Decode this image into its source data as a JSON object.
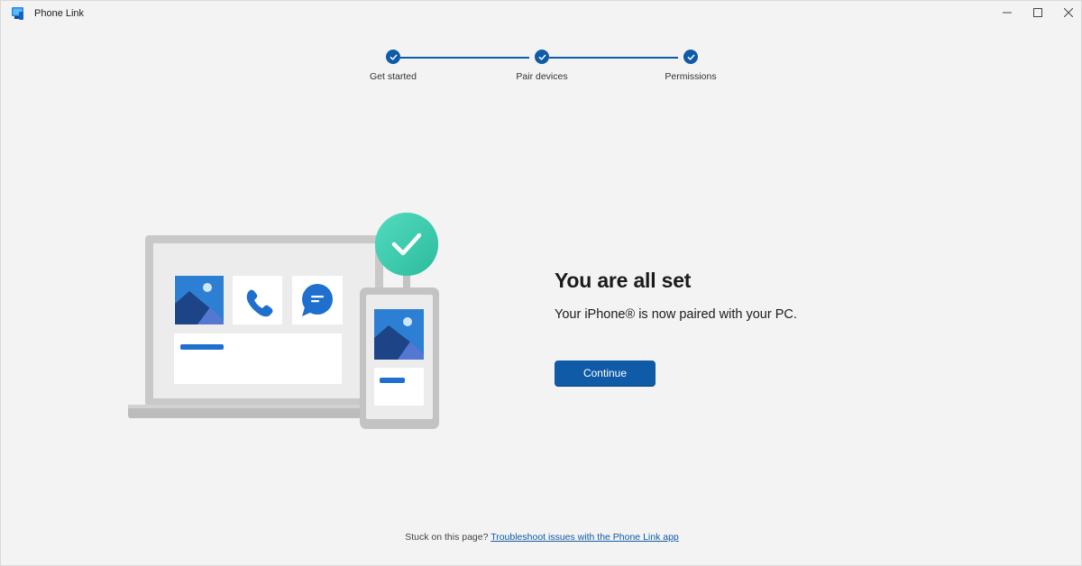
{
  "window": {
    "title": "Phone Link",
    "icons": {
      "app": "phone-link-app-icon",
      "minimize": "minimize-icon",
      "maximize": "maximize-icon",
      "close": "close-icon"
    }
  },
  "stepper": {
    "steps": [
      {
        "label": "Get started",
        "status": "complete"
      },
      {
        "label": "Pair devices",
        "status": "complete"
      },
      {
        "label": "Permissions",
        "status": "complete"
      }
    ],
    "accent_color": "#0f5ba8"
  },
  "main": {
    "heading": "You are all set",
    "subtext": "Your iPhone® is now paired with your PC.",
    "continue_label": "Continue"
  },
  "footer": {
    "prompt": "Stuck on this page?",
    "link_text": "Troubleshoot issues with the Phone Link app"
  },
  "colors": {
    "accent": "#0f5ba8",
    "success": "#3ccfb0",
    "background": "#f3f3f3"
  }
}
